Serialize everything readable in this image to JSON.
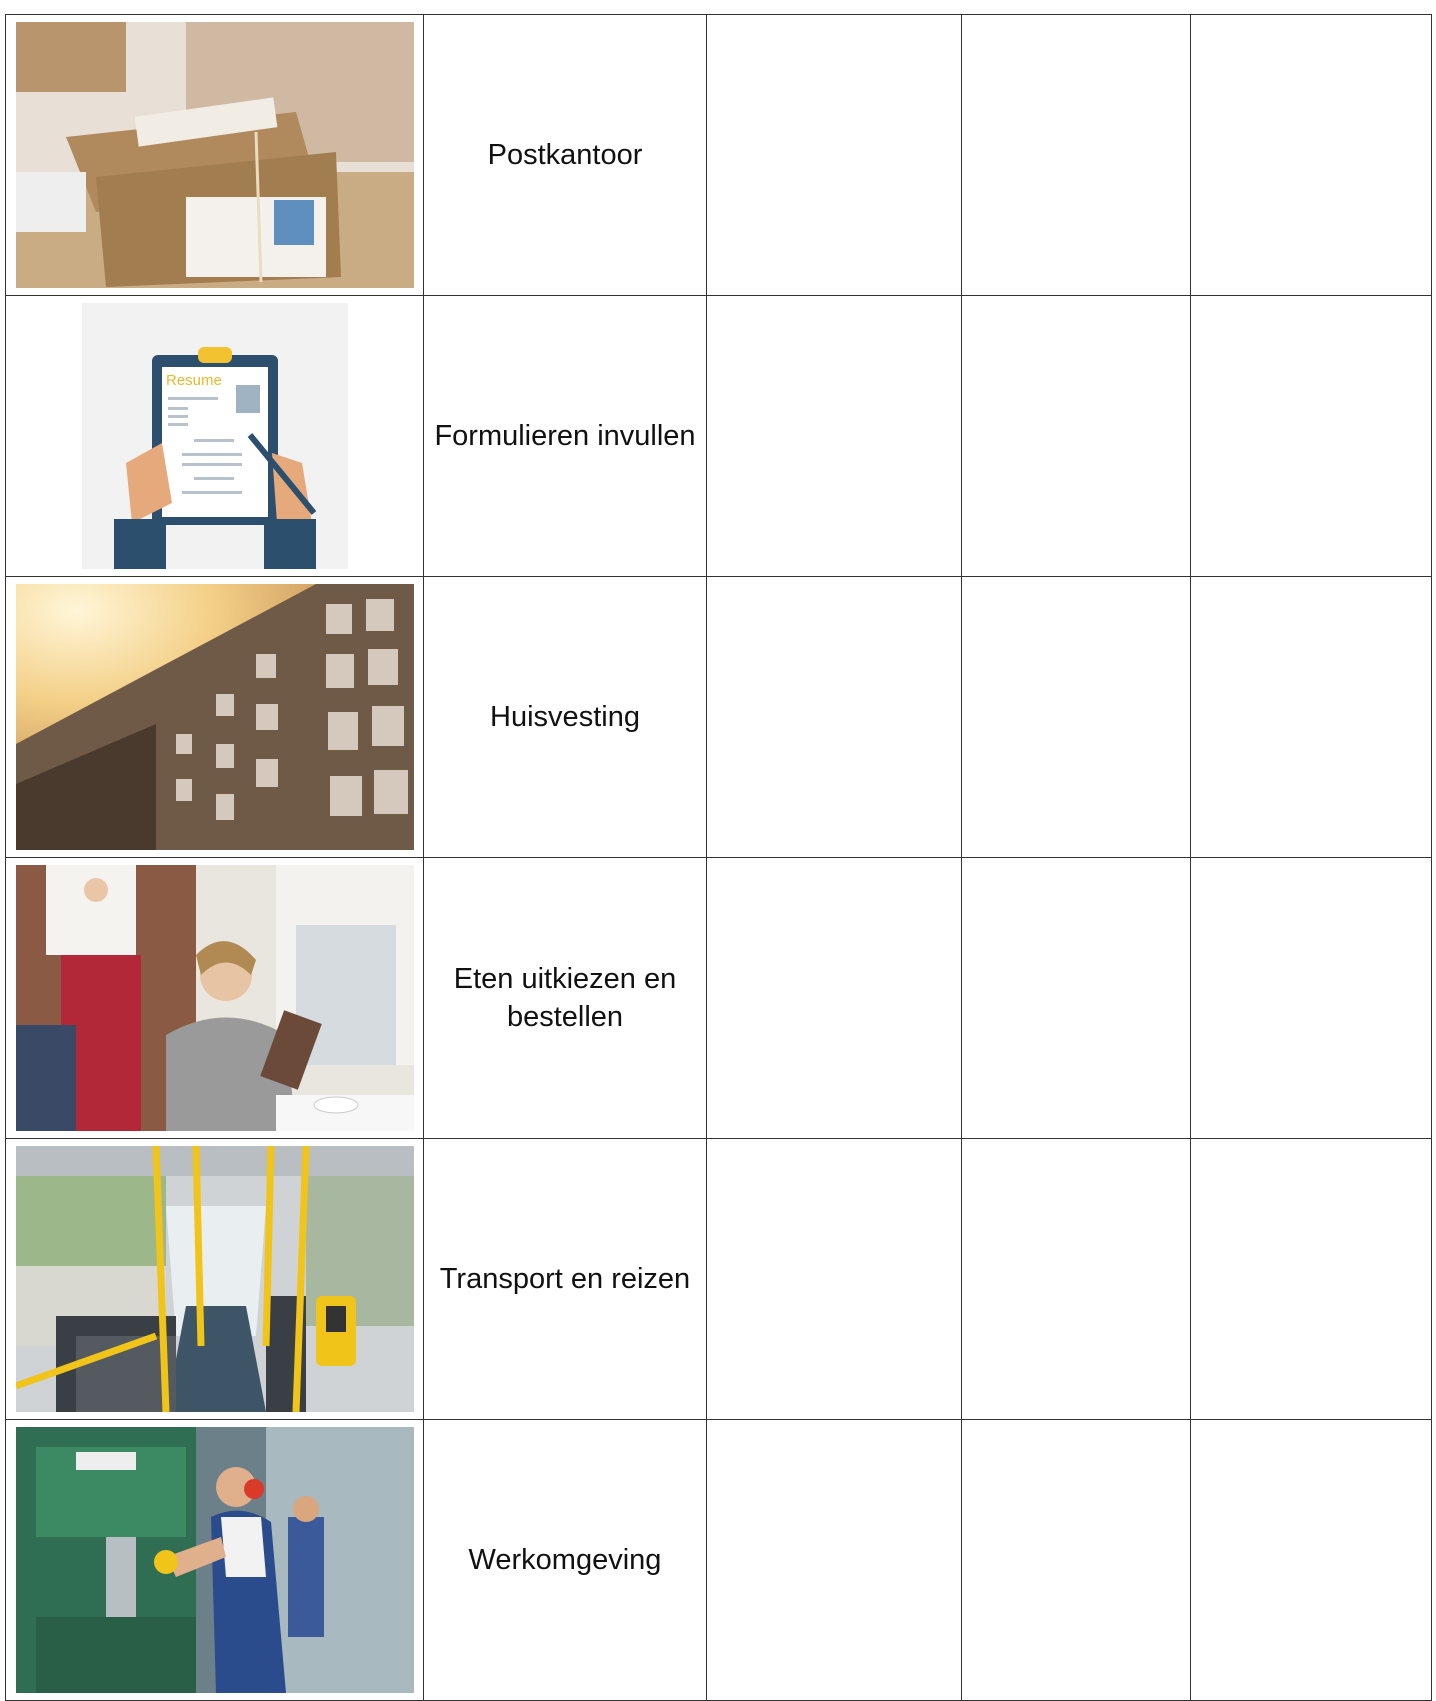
{
  "rows": [
    {
      "label": "Postkantoor",
      "image": "parcels-photo"
    },
    {
      "label": "Formulieren invullen",
      "image": "resume-clipboard-illustration",
      "image_text": "Resume"
    },
    {
      "label": "Huisvesting",
      "image": "apartment-building-photo"
    },
    {
      "label": "Eten uitkiezen en bestellen",
      "image": "restaurant-order-photo"
    },
    {
      "label": "Transport en reizen",
      "image": "bus-interior-photo"
    },
    {
      "label": "Werkomgeving",
      "image": "factory-worker-photo"
    }
  ]
}
